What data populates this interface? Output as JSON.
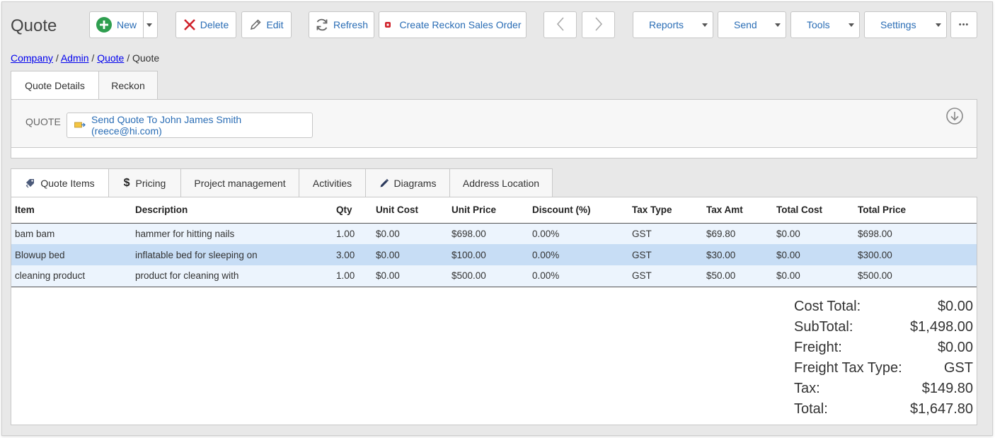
{
  "page": {
    "title": "Quote"
  },
  "toolbar": {
    "new_label": "New",
    "delete_label": "Delete",
    "edit_label": "Edit",
    "refresh_label": "Refresh",
    "create_reckon_label": "Create Reckon Sales Order",
    "reports_label": "Reports",
    "send_label": "Send",
    "tools_label": "Tools",
    "settings_label": "Settings",
    "more_label": "•••"
  },
  "breadcrumb": {
    "items": [
      "Company",
      "Admin",
      "Quote"
    ],
    "current": "Quote",
    "separator": "/"
  },
  "top_tabs": [
    {
      "label": "Quote Details"
    },
    {
      "label": "Reckon"
    }
  ],
  "quote_panel": {
    "label": "QUOTE",
    "send_button": "Send Quote To John James Smith (reece@hi.com)"
  },
  "item_tabs": [
    {
      "label": "Quote Items"
    },
    {
      "label": "Pricing"
    },
    {
      "label": "Project management"
    },
    {
      "label": "Activities"
    },
    {
      "label": "Diagrams"
    },
    {
      "label": "Address Location"
    }
  ],
  "table": {
    "headers": [
      "Item",
      "Description",
      "Qty",
      "Unit Cost",
      "Unit Price",
      "Discount (%)",
      "Tax Type",
      "Tax Amt",
      "Total Cost",
      "Total Price"
    ],
    "rows": [
      [
        "bam bam",
        "hammer for hitting nails",
        "1.00",
        "$0.00",
        "$698.00",
        "0.00%",
        "GST",
        "$69.80",
        "$0.00",
        "$698.00"
      ],
      [
        "Blowup bed",
        "inflatable bed for sleeping on",
        "3.00",
        "$0.00",
        "$100.00",
        "0.00%",
        "GST",
        "$30.00",
        "$0.00",
        "$300.00"
      ],
      [
        "cleaning product",
        "product for cleaning with",
        "1.00",
        "$0.00",
        "$500.00",
        "0.00%",
        "GST",
        "$50.00",
        "$0.00",
        "$500.00"
      ]
    ]
  },
  "totals": [
    {
      "label": "Cost Total:",
      "value": "$0.00"
    },
    {
      "label": "SubTotal:",
      "value": "$1,498.00"
    },
    {
      "label": "Freight:",
      "value": "$0.00"
    },
    {
      "label": "Freight Tax Type:",
      "value": "GST"
    },
    {
      "label": "Tax:",
      "value": "$149.80"
    },
    {
      "label": "Total:",
      "value": "$1,647.80"
    }
  ],
  "colors": {
    "link": "#2a6db5",
    "new_icon": "#2e9e4f",
    "delete_icon": "#d0222b",
    "selected_row": "#c7ddf5",
    "alt_row": "#ecf4fd"
  }
}
